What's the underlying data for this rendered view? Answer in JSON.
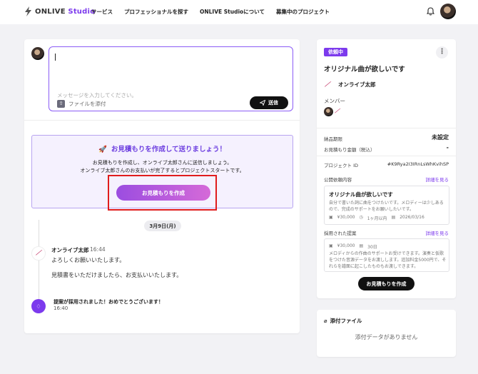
{
  "header": {
    "logo_text": "ONLIVE",
    "logo_text_accent": "Studio",
    "nav": [
      "サービス",
      "プロフェッショナルを探す",
      "ONLIVE Studioについて",
      "募集中のプロジェクト"
    ],
    "icons": [
      "bell-icon",
      "user-avatar"
    ]
  },
  "composer": {
    "placeholder": "メッセージを入力してください。",
    "attach_label": "ファイルを添付",
    "send_label": "送信"
  },
  "estimate": {
    "title": "お見積もりを作成して送りましょう！",
    "desc_line1": "お見積もりを作成し、オンライブ太郎さんに送信しましょう。",
    "desc_line2": "オンライブ太郎さんのお支払いが完了するとプロジェクトスタートです。",
    "button": "お見積もりを作成"
  },
  "timeline": {
    "date": "3月9日(月)",
    "message": {
      "author": "オンライブ太郎",
      "time": "16:44",
      "line1": "よろしくお願いいたします。",
      "line2": "見積書をいただけましたら、お支払いいたします。"
    },
    "event": {
      "text": "提案が採用されました！おめでとうございます！",
      "time": "16:40"
    }
  },
  "side": {
    "status": "依頼中",
    "title": "オリジナル曲が欲しいです",
    "owner": "オンライブ太郎",
    "member_label": "メンバー",
    "deadline_label": "納品期限",
    "deadline_value": "未設定",
    "amount_label": "お見積もり金額（税込）",
    "amount_value": "-",
    "project_id_label": "プロジェクト ID",
    "project_id_value": "#K9Rya2I3IRnLsWhKvihSP",
    "public_label": "公開依頼内容",
    "detail_link": "詳細を見る",
    "public_card": {
      "title": "オリジナル曲が欲しいです",
      "desc": "自分で書いた詞に曲をつけたいです。メロディーは少しあるので、完成のサポートをお願いしたいです。",
      "price": "¥30,000",
      "duration": "1ヶ月以内",
      "date": "2026/03/16"
    },
    "adopted_label": "採用された提案",
    "adopted_card": {
      "price": "¥30,000",
      "duration": "30日",
      "desc": "メロディからの作曲のサポートお受けできます。演奏と仮歌をつけた音源データをお渡しします。追加料金5000円で、それらを譜面に起こしたものもお渡しできます。"
    },
    "button": "お見積もりを作成"
  },
  "attachments": {
    "title": "添付ファイル",
    "empty": "添付データがありません"
  },
  "colors": {
    "accent": "#7c3aed",
    "highlight_border": "#e01c1c"
  }
}
